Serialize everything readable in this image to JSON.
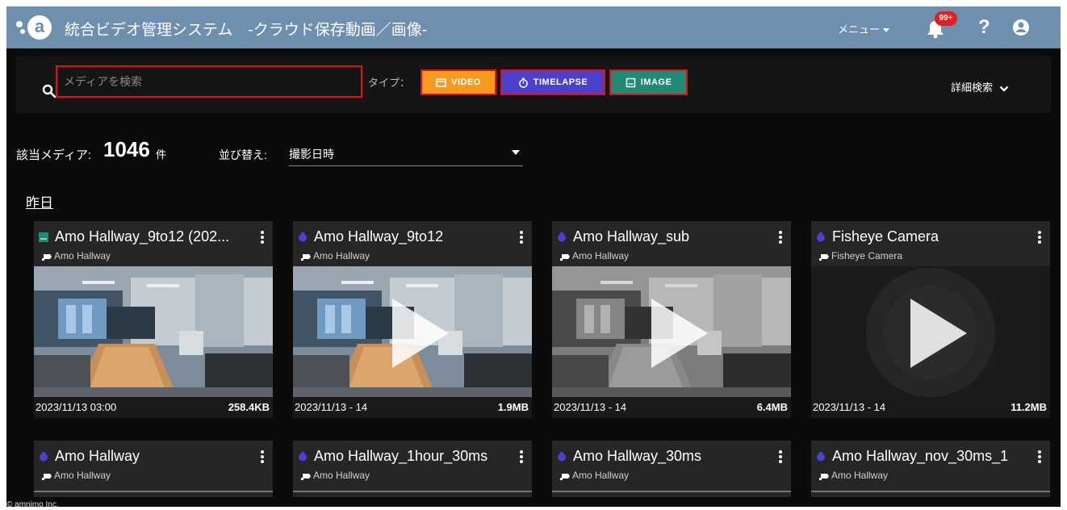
{
  "header": {
    "title": "統合ビデオ管理システム　-クラウド保存動画／画像-",
    "menu_label": "メニュー",
    "notification_badge": "99+",
    "help_label": "?"
  },
  "search": {
    "placeholder": "メディアを検索",
    "type_label": "タイプ：",
    "chips": {
      "video": "VIDEO",
      "timelapse": "TIMELAPSE",
      "image": "IMAGE"
    },
    "advanced_label": "詳細検索"
  },
  "results": {
    "count_label": "該当メディア:",
    "count": "1046",
    "count_unit": "件",
    "sort_label": "並び替え:",
    "sort_value": "撮影日時"
  },
  "section_title": "昨日",
  "colors": {
    "header": "#6f8fae",
    "video": "#f59a1c",
    "timelapse": "#4b41cc",
    "image": "#1f8a76",
    "highlight": "#e40f0f"
  },
  "cards_row1": [
    {
      "type": "image",
      "title": "Amo Hallway_9to12 (202...",
      "camera": "Amo Hallway",
      "date": "2023/11/13 03:00",
      "size": "258.4KB"
    },
    {
      "type": "timelapse",
      "title": "Amo Hallway_9to12",
      "camera": "Amo Hallway",
      "date": "2023/11/13 - 14",
      "size": "1.9MB"
    },
    {
      "type": "timelapse",
      "title": "Amo Hallway_sub",
      "camera": "Amo Hallway",
      "date": "2023/11/13 - 14",
      "size": "6.4MB"
    },
    {
      "type": "timelapse",
      "title": "Fisheye Camera",
      "camera": "Fisheye Camera",
      "date": "2023/11/13 - 14",
      "size": "11.2MB"
    }
  ],
  "cards_row2": [
    {
      "type": "timelapse",
      "title": "Amo Hallway",
      "camera": "Amo Hallway"
    },
    {
      "type": "timelapse",
      "title": "Amo Hallway_1hour_30ms",
      "camera": "Amo Hallway"
    },
    {
      "type": "timelapse",
      "title": "Amo Hallway_30ms",
      "camera": "Amo Hallway"
    },
    {
      "type": "timelapse",
      "title": "Amo Hallway_nov_30ms_1",
      "camera": "Amo Hallway"
    }
  ],
  "footer": {
    "copyright": "© amnimo Inc."
  }
}
